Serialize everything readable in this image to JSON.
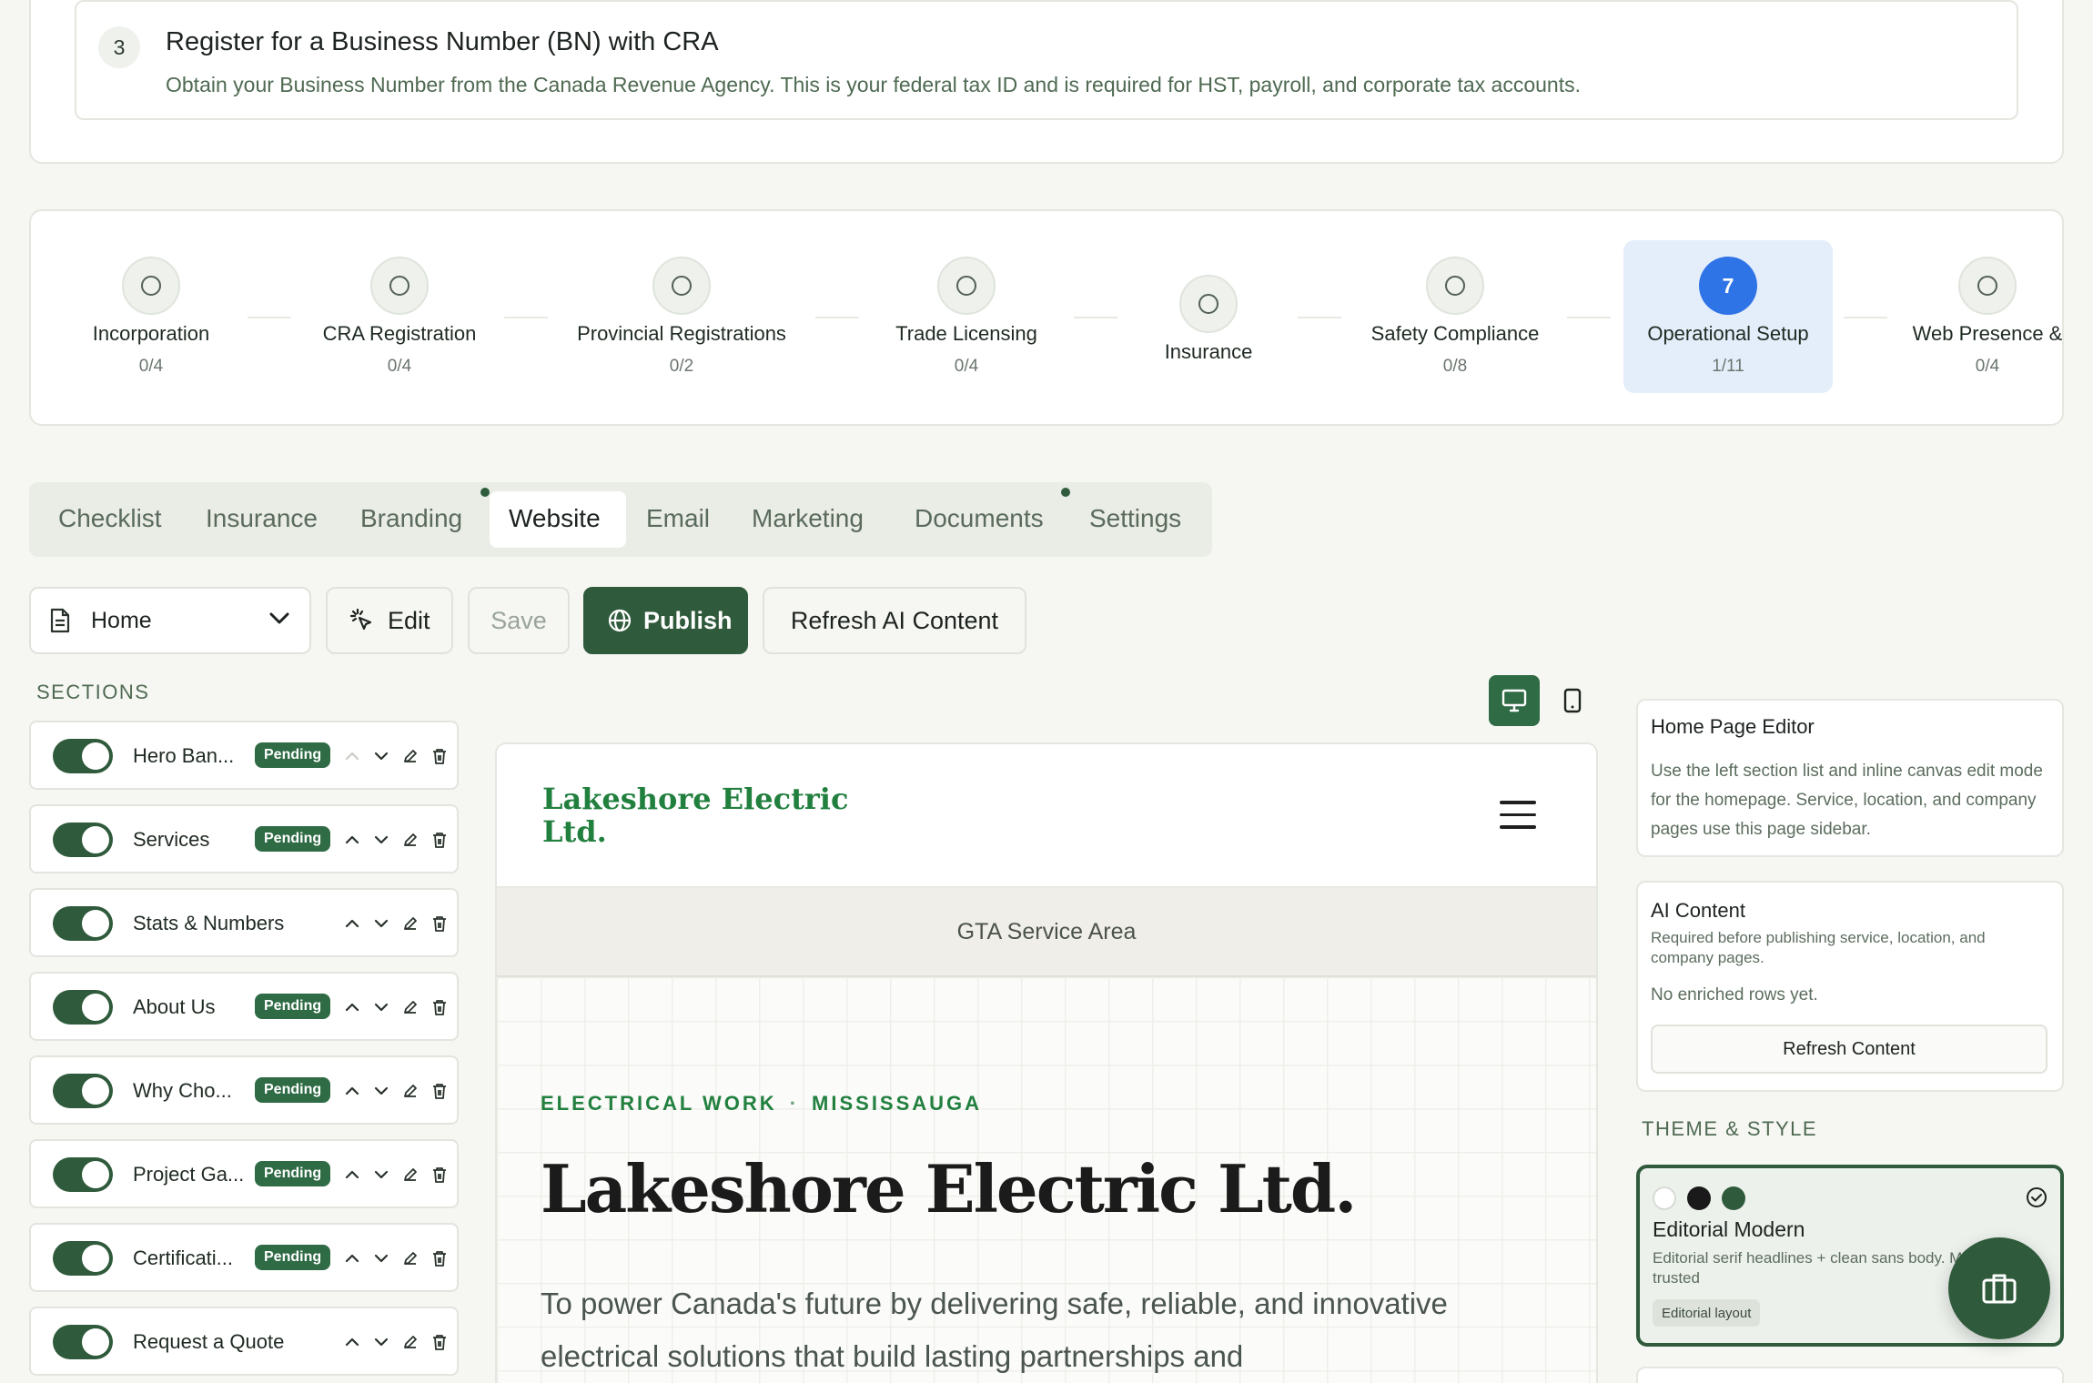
{
  "step": {
    "number": "3",
    "title": "Register for a Business Number (BN) with CRA",
    "description": "Obtain your Business Number from the Canada Revenue Agency. This is your federal tax ID and is required for HST, payroll, and corporate tax accounts."
  },
  "stages": [
    {
      "name": "Incorporation",
      "count": "0/4",
      "completed": 0,
      "total": 4
    },
    {
      "name": "CRA Registration",
      "count": "0/4",
      "completed": 0,
      "total": 4
    },
    {
      "name": "Provincial Registrations",
      "count": "0/2",
      "completed": 0,
      "total": 2
    },
    {
      "name": "Trade Licensing",
      "count": "0/4",
      "completed": 0,
      "total": 4
    },
    {
      "name": "Insurance",
      "count": ""
    },
    {
      "name": "Safety Compliance",
      "count": "0/8",
      "completed": 0,
      "total": 8
    },
    {
      "name": "Operational Setup",
      "count": "1/11",
      "number": "7",
      "active": true,
      "completed": 1,
      "total": 11
    },
    {
      "name": "Web Presence &",
      "count": "0/4",
      "completed": 0,
      "total": 4
    }
  ],
  "tabs": [
    "Checklist",
    "Insurance",
    "Branding",
    "Website",
    "Email",
    "Marketing",
    "Documents",
    "Settings"
  ],
  "active_tab": "Website",
  "toolbar": {
    "page_select": "Home",
    "edit": "Edit",
    "save": "Save",
    "publish": "Publish",
    "refresh_ai": "Refresh AI Content"
  },
  "sections": {
    "heading": "SECTIONS",
    "pending_label": "Pending",
    "items": [
      {
        "label": "Hero Ban...",
        "pending": true,
        "enabled": true
      },
      {
        "label": "Services",
        "pending": true,
        "enabled": true
      },
      {
        "label": "Stats & Numbers",
        "pending": false,
        "enabled": true
      },
      {
        "label": "About Us",
        "pending": true,
        "enabled": true
      },
      {
        "label": "Why Cho...",
        "pending": true,
        "enabled": true
      },
      {
        "label": "Project Ga...",
        "pending": true,
        "enabled": true
      },
      {
        "label": "Certificati...",
        "pending": true,
        "enabled": true
      },
      {
        "label": "Request a Quote",
        "pending": false,
        "enabled": true
      }
    ]
  },
  "preview": {
    "logo": "Lakeshore Electric Ltd.",
    "service_area": "GTA Service Area",
    "eyebrow_left": "ELECTRICAL WORK",
    "eyebrow_sep": "·",
    "eyebrow_right": "MISSISSAUGA",
    "title": "Lakeshore Electric Ltd.",
    "subtitle": "To power Canada's future by delivering safe, reliable, and innovative electrical solutions that build lasting partnerships and"
  },
  "right_panel": {
    "editor_title": "Home Page Editor",
    "editor_text": "Use the left section list and inline canvas edit mode for the homepage. Service, location, and company pages use this page sidebar.",
    "ai_title": "AI Content",
    "ai_text": "Required before publishing service, location, and company pages.",
    "ai_status": "No enriched rows yet.",
    "ai_button": "Refresh Content",
    "theme_heading": "THEME & STYLE",
    "theme_name": "Editorial Modern",
    "theme_desc": "Editorial serif headlines + clean sans body. Modern and trusted",
    "theme_tag": "Editorial layout",
    "theme_swatches": [
      "#ffffff",
      "#1a1a1a",
      "#2f5a3b"
    ]
  },
  "colors": {
    "accent": "#2f5a3b",
    "brand_green": "#22803f",
    "active_blue": "#2f74e6"
  },
  "icons": {
    "page": "document-icon",
    "select": "chevron-down-icon",
    "edit": "cursor-click-icon",
    "publish": "globe-icon",
    "desktop": "desktop-icon",
    "mobile": "mobile-icon",
    "menu": "hamburger-icon",
    "theme_selected": "check-circle-icon",
    "fab": "briefcase-icon"
  }
}
